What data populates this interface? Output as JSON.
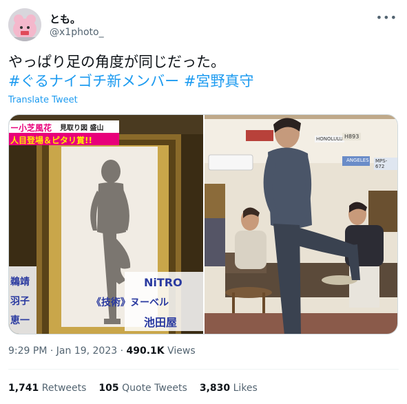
{
  "user": {
    "display_name": "とも。",
    "handle": "@x1photo_",
    "avatar": "pink-plush-toy-avatar"
  },
  "tweet": {
    "text_line": "やっぱり足の角度が同じだった。",
    "hashtags": [
      "#ぐるナイゴチ新メンバー",
      "#宮野真守"
    ],
    "translate_label": "Translate Tweet"
  },
  "media": {
    "left": {
      "caption_top_1": "ー小芝風花",
      "caption_top_2": "見取り図 盛山",
      "caption_top_3": "人目登場＆ピタリ賞!!",
      "left_col_1": "鵜靖",
      "left_col_2": "羽子",
      "left_col_3": "恵一",
      "right_col_1": "NiTRO",
      "right_col_2": "《技術》ヌーベル",
      "right_col_3": "池田屋"
    },
    "right": {
      "plate_1": "HONOLULU",
      "plate_2": "H893",
      "plate_3": "ANGELES",
      "plate_4": "MPS-672"
    }
  },
  "meta": {
    "time": "9:29 PM",
    "separator": "·",
    "date": "Jan 19, 2023",
    "views_count": "490.1K",
    "views_label": "Views"
  },
  "stats": {
    "retweets_count": "1,741",
    "retweets_label": "Retweets",
    "quotes_count": "105",
    "quotes_label": "Quote Tweets",
    "likes_count": "3,830",
    "likes_label": "Likes"
  },
  "colors": {
    "accent": "#1d9bf0",
    "secondary_text": "#536471",
    "primary_text": "#0f1419"
  }
}
